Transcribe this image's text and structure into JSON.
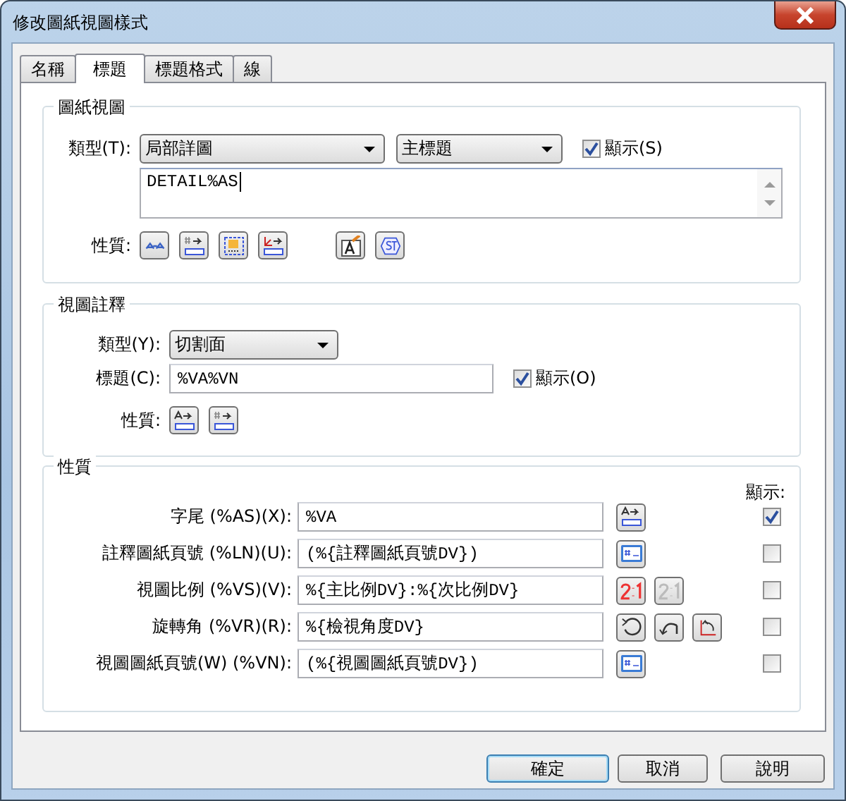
{
  "window": {
    "title": "修改圖紙視圖樣式"
  },
  "tabs": [
    {
      "label": "名稱",
      "selected": false
    },
    {
      "label": "標題",
      "selected": true
    },
    {
      "label": "標題格式",
      "selected": false
    },
    {
      "label": "線",
      "selected": false
    }
  ],
  "drawing_view": {
    "title": "圖紙視圖",
    "type_label": "類型(T):",
    "type_value": "局部詳圖",
    "subtype_value": "主標題",
    "show": {
      "label": "顯示(S)",
      "checked": true
    },
    "text": "DETAIL%AS",
    "properties_label": "性質:",
    "tools": [
      {
        "kind": "aa"
      },
      {
        "kind": "hash-arrow"
      },
      {
        "kind": "frame"
      },
      {
        "kind": "angle-arrow"
      },
      {
        "kind": "gap"
      },
      {
        "kind": "text-style"
      },
      {
        "kind": "st"
      }
    ]
  },
  "view_annotation": {
    "title": "視圖註釋",
    "type_label": "類型(Y):",
    "type_value": "切割面",
    "caption_label": "標題(C):",
    "caption_value": "%VA%VN",
    "show": {
      "label": "顯示(O)",
      "checked": true
    },
    "properties_label": "性質:",
    "tools": [
      {
        "kind": "text-arrow"
      },
      {
        "kind": "hash-arrow"
      }
    ]
  },
  "properties": {
    "title": "性質",
    "show_header": "顯示:",
    "rows": [
      {
        "label": "字尾 (%AS)(X):",
        "value": "%VA",
        "tools": [
          {
            "kind": "text-arrow"
          }
        ],
        "show": true
      },
      {
        "label": "註釋圖紙頁號 (%LN)(U):",
        "value": "(%{註釋圖紙頁號DV})",
        "tools": [
          {
            "kind": "sheet"
          }
        ],
        "show": false
      },
      {
        "label": "視圖比例 (%VS)(V):",
        "value": "%{主比例DV}:%{次比例DV}",
        "tools": [
          {
            "kind": "scale-red"
          },
          {
            "kind": "scale-grey"
          }
        ],
        "show": false
      },
      {
        "label": "旋轉角 (%VR)(R):",
        "value": "%{檢視角度DV}",
        "tools": [
          {
            "kind": "rotate-circle"
          },
          {
            "kind": "rotate-arc"
          },
          {
            "kind": "rotate-angle"
          }
        ],
        "show": false
      },
      {
        "label": "視圖圖紙頁號(W) (%VN):",
        "value": "(%{視圖圖紙頁號DV})",
        "tools": [
          {
            "kind": "sheet"
          }
        ],
        "show": false
      }
    ]
  },
  "buttons": [
    {
      "label": "確定",
      "default": true
    },
    {
      "label": "取消",
      "default": false
    },
    {
      "label": "說明",
      "default": false
    }
  ]
}
